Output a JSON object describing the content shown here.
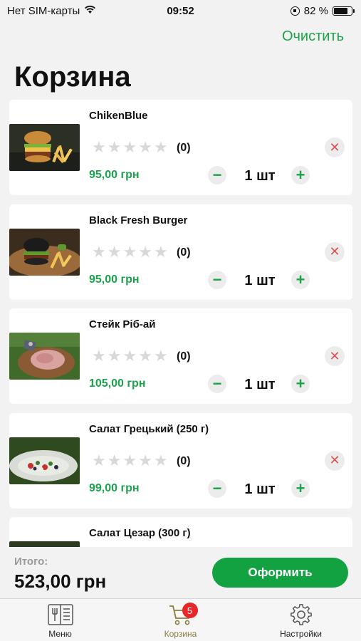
{
  "status_bar": {
    "carrier": "Нет SIM-карты",
    "time": "09:52",
    "battery": "82 %",
    "battery_level": 0.82,
    "icons": [
      "wifi-icon",
      "orientation-lock-icon",
      "battery-icon"
    ]
  },
  "header": {
    "clear_label": "Очистить",
    "title": "Корзина"
  },
  "items": [
    {
      "name": "ChikenBlue",
      "rating": 0,
      "reviews": "(0)",
      "price": "95,00 грн",
      "qty": "1 шт",
      "image": "burger-with-fries"
    },
    {
      "name": "Black Fresh Burger",
      "rating": 0,
      "reviews": "(0)",
      "price": "95,00 грн",
      "qty": "1 шт",
      "image": "black-burger-with-fries"
    },
    {
      "name": "Стейк Ріб-ай",
      "rating": 0,
      "reviews": "(0)",
      "price": "105,00 грн",
      "qty": "1 шт",
      "image": "steak-on-board"
    },
    {
      "name": "Салат Грецький (250 г)",
      "rating": 0,
      "reviews": "(0)",
      "price": "99,00 грн",
      "qty": "1 шт",
      "image": "greek-salad-plate"
    },
    {
      "name": "Салат Цезар (300 г)",
      "rating": 0,
      "reviews": "",
      "price": "",
      "qty": "",
      "image": "caesar-salad"
    }
  ],
  "checkout": {
    "total_label": "Итого:",
    "total_value": "523,00 грн",
    "button_label": "Оформить"
  },
  "tabs": [
    {
      "label": "Меню",
      "icon": "menu-book-icon",
      "active": false
    },
    {
      "label": "Корзина",
      "icon": "cart-icon",
      "active": true,
      "badge": "5"
    },
    {
      "label": "Настройки",
      "icon": "gear-icon",
      "active": false
    }
  ],
  "colors": {
    "accent_green": "#1aa34a",
    "remove_red": "#e05353",
    "badge_red": "#e8272a",
    "active_tab": "#8b7d3e"
  }
}
